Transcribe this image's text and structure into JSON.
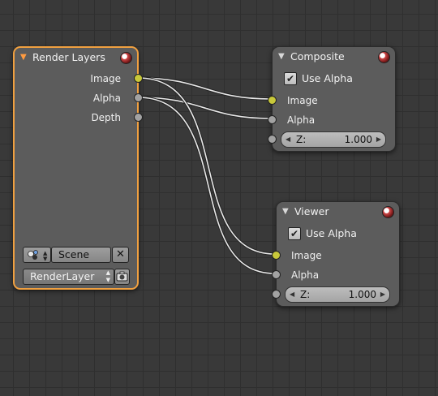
{
  "render_layers": {
    "title": "Render Layers",
    "outputs": [
      {
        "label": "Image",
        "kind": "image"
      },
      {
        "label": "Alpha",
        "kind": "value"
      },
      {
        "label": "Depth",
        "kind": "value"
      }
    ],
    "scene_name": "Scene",
    "layer_name": "RenderLayer",
    "icons": [
      "collapse-arrow-icon",
      "preview-ball-icon",
      "scene-browse-icon",
      "close-icon",
      "updown-arrows-icon",
      "render-camera-icon"
    ]
  },
  "composite": {
    "title": "Composite",
    "use_alpha_label": "Use Alpha",
    "use_alpha": true,
    "inputs": [
      {
        "label": "Image",
        "kind": "image"
      },
      {
        "label": "Alpha",
        "kind": "value"
      }
    ],
    "z_label": "Z:",
    "z_value": "1.000"
  },
  "viewer": {
    "title": "Viewer",
    "use_alpha_label": "Use Alpha",
    "use_alpha": true,
    "inputs": [
      {
        "label": "Image",
        "kind": "image"
      },
      {
        "label": "Alpha",
        "kind": "value"
      }
    ],
    "z_label": "Z:",
    "z_value": "1.000"
  },
  "links": [
    {
      "from": "render_layers.Image",
      "to": "composite.Image"
    },
    {
      "from": "render_layers.Alpha",
      "to": "composite.Alpha"
    },
    {
      "from": "render_layers.Image",
      "to": "viewer.Image"
    },
    {
      "from": "render_layers.Alpha",
      "to": "viewer.Alpha"
    }
  ],
  "colors": {
    "background": "#393939",
    "node_body": "#5c5c5c",
    "selected_outline": "#f0a040",
    "image_socket": "#c8c83a",
    "value_socket": "#a2a2a2",
    "wire": "#e8e8e8"
  }
}
